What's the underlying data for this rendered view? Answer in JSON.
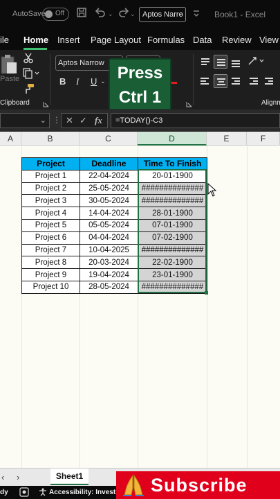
{
  "titlebar": {
    "autosave_label": "AutoSave",
    "toggle_state": "Off",
    "font_name": "Aptos Narro",
    "doc_title": "Book1 - Excel"
  },
  "tabs": [
    "ile",
    "Home",
    "Insert",
    "Page Layout",
    "Formulas",
    "Data",
    "Review",
    "View"
  ],
  "active_tab": "Home",
  "ribbon": {
    "paste_label": "Paste",
    "clipboard_label": "Clipboard",
    "font_name": "Aptos Narrow",
    "bold": "B",
    "italic": "I",
    "underline": "U",
    "alignment_label": "Alignm"
  },
  "overlay": {
    "line1": "Press",
    "line2": "Ctrl 1"
  },
  "formula_bar": {
    "fx": "fx",
    "formula": "=TODAY()-C3"
  },
  "columns": [
    "A",
    "B",
    "C",
    "D",
    "E",
    "F"
  ],
  "selected_column": "D",
  "table": {
    "headers": [
      "Project",
      "Deadline",
      "Time To Finish"
    ],
    "rows": [
      [
        "Project 1",
        "22-04-2024",
        "20-01-1900"
      ],
      [
        "Project 2",
        "25-05-2024",
        "##############"
      ],
      [
        "Project 3",
        "30-05-2024",
        "##############"
      ],
      [
        "Project 4",
        "14-04-2024",
        "28-01-1900"
      ],
      [
        "Project 5",
        "05-05-2024",
        "07-01-1900"
      ],
      [
        "Project 6",
        "04-04-2024",
        "07-02-1900"
      ],
      [
        "Project 7",
        "10-04-2025",
        "##############"
      ],
      [
        "Project 8",
        "20-03-2024",
        "22-02-1900"
      ],
      [
        "Project 9",
        "19-04-2024",
        "23-01-1900"
      ],
      [
        "Project 10",
        "28-05-2024",
        "##############"
      ]
    ]
  },
  "sheet_tab": "Sheet1",
  "statusbar": {
    "ready": "dy",
    "accessibility": "Accessibility: Investig"
  },
  "banner": {
    "text": "Subscribe"
  },
  "colors": {
    "header_fill": "#00b0f0",
    "selection": "#217346",
    "banner": "#e0001b",
    "overlay": "#1a5e36"
  }
}
